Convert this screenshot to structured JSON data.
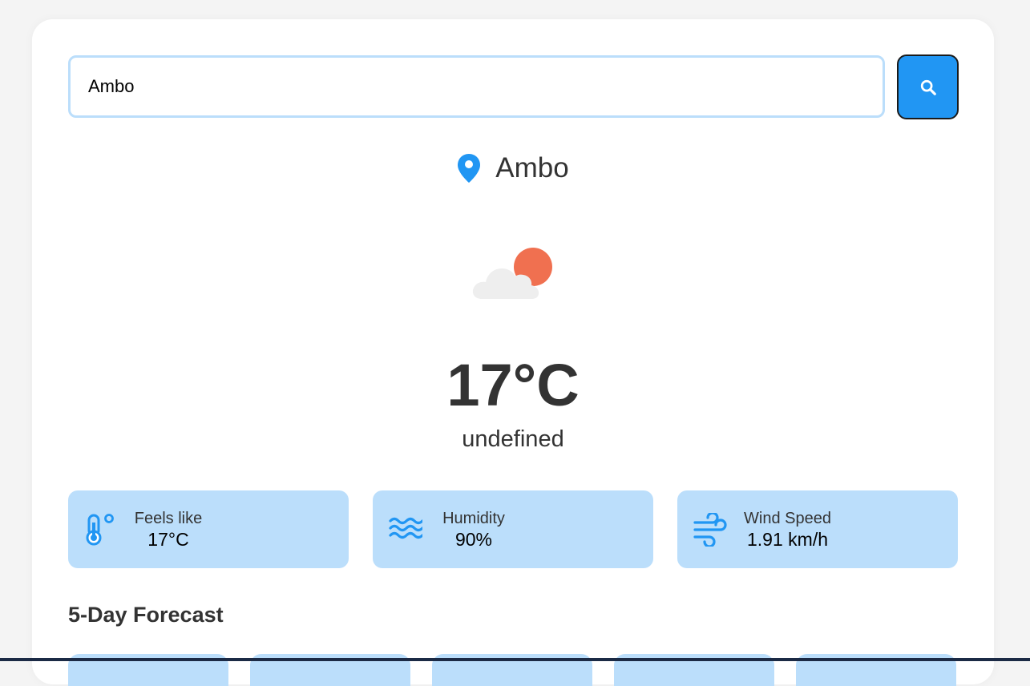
{
  "search": {
    "value": "Ambo",
    "button_icon": "search-icon"
  },
  "location": {
    "icon": "location-pin-icon",
    "name": "Ambo"
  },
  "weather": {
    "icon": "cloud-sun-icon",
    "temperature": "17°C",
    "description": "undefined"
  },
  "stats": [
    {
      "icon": "thermometer-icon",
      "label": "Feels like",
      "value": "17°C"
    },
    {
      "icon": "water-waves-icon",
      "label": "Humidity",
      "value": "90%"
    },
    {
      "icon": "wind-icon",
      "label": "Wind Speed",
      "value": "1.91 km/h"
    }
  ],
  "forecast": {
    "title": "5-Day Forecast"
  },
  "colors": {
    "accent": "#2196f3",
    "card_light": "#bbdefb",
    "sun": "#f07050",
    "cloud": "#eeeeee"
  }
}
